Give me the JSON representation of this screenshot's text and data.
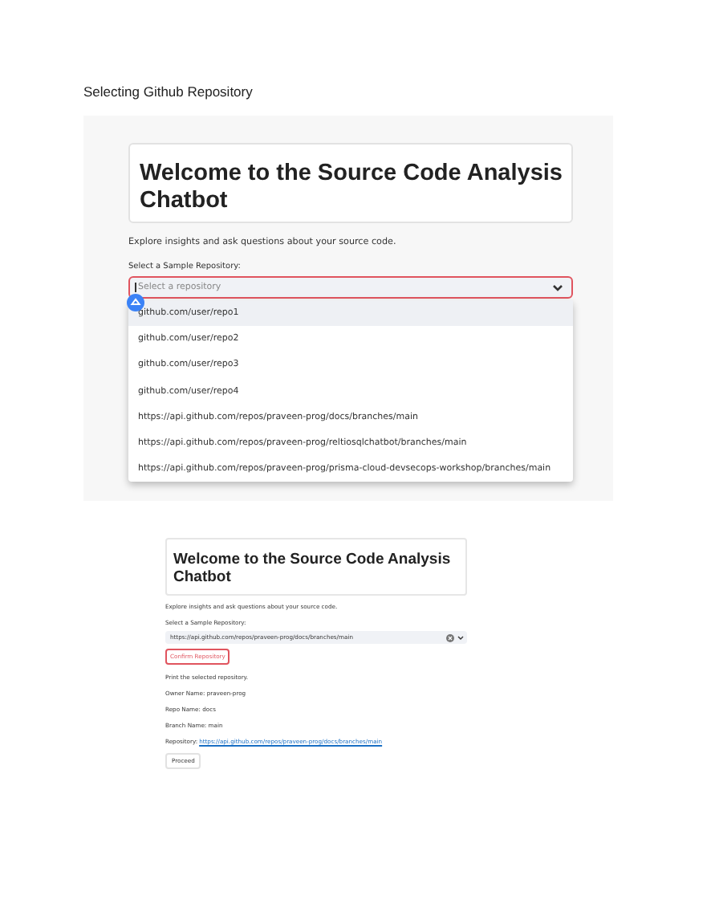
{
  "heading": "Selecting Github Repository",
  "dropdown_view": {
    "title": "Welcome to the Source Code Analysis Chatbot",
    "intro": "Explore insights and ask questions about your source code.",
    "select_label": "Select a Sample Repository:",
    "select": {
      "placeholder": "Select a repository",
      "focused": true
    },
    "options": [
      {
        "label": "github.com/user/repo1",
        "selected": true
      },
      {
        "label": "github.com/user/repo2",
        "selected": false
      },
      {
        "label": "github.com/user/repo3",
        "selected": false
      },
      {
        "label": "github.com/user/repo4",
        "selected": false
      },
      {
        "label": "https://api.github.com/repos/praveen-prog/docs/branches/main",
        "selected": false
      },
      {
        "label": "https://api.github.com/repos/praveen-prog/reltiosqlchatbot/branches/main",
        "selected": false
      },
      {
        "label": "https://api.github.com/repos/praveen-prog/prisma-cloud-devsecops-workshop/branches/main",
        "selected": false
      }
    ]
  },
  "result_view": {
    "title": "Welcome to the Source Code Analysis Chatbot",
    "intro": "Explore insights and ask questions about your source code.",
    "select_label": "Select a Sample Repository:",
    "select": {
      "value": "https://api.github.com/repos/praveen-prog/docs/branches/main"
    },
    "confirm_button": "Confirm Repository",
    "lines": [
      "Print the selected repository.",
      "Owner Name: praveen-prog",
      "Repo Name: docs",
      "Branch Name: main"
    ],
    "repository_label": "Repository:",
    "repository_link": "https://api.github.com/repos/praveen-prog/docs/branches/main",
    "proceed_button": "Proceed"
  }
}
